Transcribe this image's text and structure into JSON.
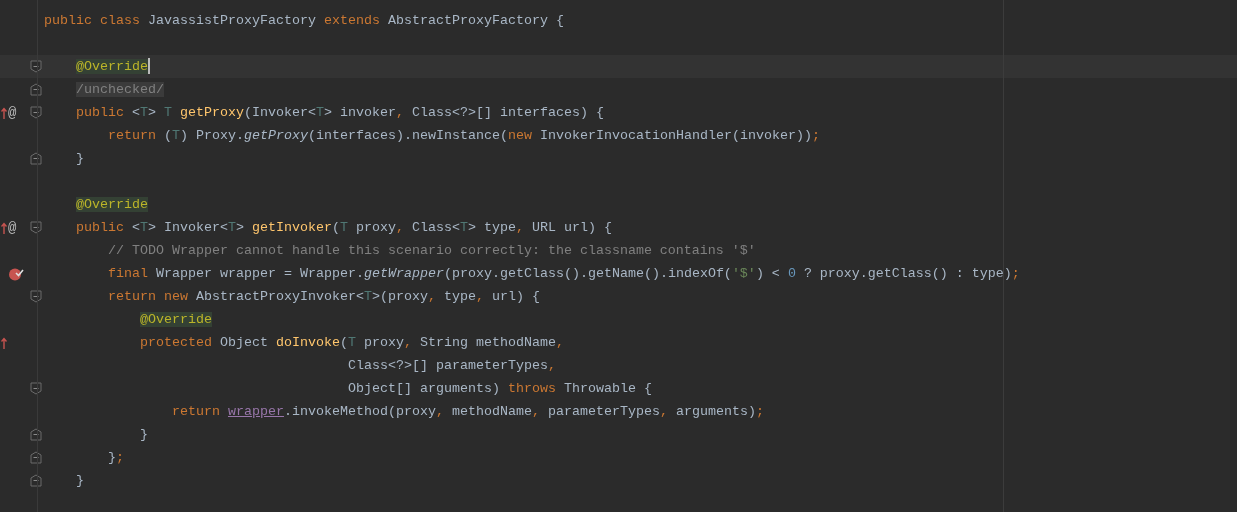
{
  "editor": {
    "lines": [
      {
        "current": false,
        "breakpoint": false,
        "overrides": false,
        "fold_start": false,
        "fold_end": false,
        "tokens": [
          {
            "kind": "k",
            "text": "public class"
          },
          {
            "kind": "p",
            "text": " JavassistProxyFactory "
          },
          {
            "kind": "k",
            "text": "extends"
          },
          {
            "kind": "p",
            "text": " AbstractProxyFactory {"
          }
        ]
      },
      {
        "current": false,
        "breakpoint": false,
        "overrides": false,
        "fold_start": false,
        "fold_end": false
      },
      {
        "current": true,
        "breakpoint": false,
        "overrides": false,
        "fold_start": true,
        "fold_end": false,
        "tokens": [
          {
            "kind": "a",
            "text": "    @Override"
          }
        ]
      },
      {
        "current": false,
        "breakpoint": false,
        "overrides": false,
        "fold_start": false,
        "fold_end": true,
        "tokens": [
          {
            "kind": "u",
            "text": "    /unchecked/"
          }
        ]
      },
      {
        "current": false,
        "breakpoint": false,
        "overrides": true,
        "gutter_symbol": "@",
        "fold_start": true,
        "fold_end": false,
        "tokens": [
          {
            "kind": "k",
            "text": "    public"
          },
          {
            "kind": "p",
            "text": " <"
          },
          {
            "kind": "t",
            "text": "T"
          },
          {
            "kind": "p",
            "text": "> "
          },
          {
            "kind": "t",
            "text": "T"
          },
          {
            "kind": "m",
            "text": " getProxy"
          },
          {
            "kind": "p",
            "text": "(Invoker<"
          },
          {
            "kind": "t",
            "text": "T"
          },
          {
            "kind": "p",
            "text": "> invoker"
          },
          {
            "kind": "k",
            "text": ","
          },
          {
            "kind": "p",
            "text": " Class<?>[] interfaces) {"
          }
        ]
      },
      {
        "current": false,
        "breakpoint": false,
        "overrides": false,
        "fold_start": false,
        "fold_end": false,
        "tokens": [
          {
            "kind": "k",
            "text": "        return"
          },
          {
            "kind": "p",
            "text": " ("
          },
          {
            "kind": "t",
            "text": "T"
          },
          {
            "kind": "p",
            "text": ") Proxy."
          },
          {
            "kind": "i",
            "text": "getProxy"
          },
          {
            "kind": "p",
            "text": "(interfaces).newInstance("
          },
          {
            "kind": "k",
            "text": "new"
          },
          {
            "kind": "p",
            "text": " InvokerInvocationHandler(invoker))"
          },
          {
            "kind": "k",
            "text": ";"
          }
        ]
      },
      {
        "current": false,
        "breakpoint": false,
        "overrides": false,
        "fold_start": false,
        "fold_end": true,
        "tokens": [
          {
            "kind": "p",
            "text": "    }"
          }
        ]
      },
      {
        "current": false,
        "breakpoint": false,
        "overrides": false,
        "fold_start": false,
        "fold_end": false
      },
      {
        "current": false,
        "breakpoint": false,
        "overrides": false,
        "fold_start": false,
        "fold_end": false,
        "tokens": [
          {
            "kind": "a",
            "text": "    @Override"
          }
        ]
      },
      {
        "current": false,
        "breakpoint": false,
        "overrides": true,
        "gutter_symbol": "@",
        "fold_start": true,
        "fold_end": false,
        "tokens": [
          {
            "kind": "k",
            "text": "    public"
          },
          {
            "kind": "p",
            "text": " <"
          },
          {
            "kind": "t",
            "text": "T"
          },
          {
            "kind": "p",
            "text": "> Invoker<"
          },
          {
            "kind": "t",
            "text": "T"
          },
          {
            "kind": "p",
            "text": "> "
          },
          {
            "kind": "m",
            "text": "getInvoker"
          },
          {
            "kind": "p",
            "text": "("
          },
          {
            "kind": "t",
            "text": "T"
          },
          {
            "kind": "p",
            "text": " proxy"
          },
          {
            "kind": "k",
            "text": ","
          },
          {
            "kind": "p",
            "text": " Class<"
          },
          {
            "kind": "t",
            "text": "T"
          },
          {
            "kind": "p",
            "text": "> type"
          },
          {
            "kind": "k",
            "text": ","
          },
          {
            "kind": "p",
            "text": " URL url) {"
          }
        ]
      },
      {
        "current": false,
        "breakpoint": false,
        "overrides": false,
        "fold_start": false,
        "fold_end": false,
        "tokens": [
          {
            "kind": "c",
            "text": "        // TODO Wrapper cannot handle this scenario correctly: the classname contains '$'"
          }
        ]
      },
      {
        "current": false,
        "breakpoint": true,
        "overrides": false,
        "fold_start": false,
        "fold_end": false,
        "tokens": [
          {
            "kind": "k",
            "text": "        final"
          },
          {
            "kind": "p",
            "text": " Wrapper wrapper = Wrapper."
          },
          {
            "kind": "i",
            "text": "getWrapper"
          },
          {
            "kind": "p",
            "text": "(proxy.getClass().getName().indexOf("
          },
          {
            "kind": "s",
            "text": "'$'"
          },
          {
            "kind": "p",
            "text": ") < "
          },
          {
            "kind": "n",
            "text": "0"
          },
          {
            "kind": "p",
            "text": " ? proxy.getClass() : type)"
          },
          {
            "kind": "k",
            "text": ";"
          }
        ]
      },
      {
        "current": false,
        "breakpoint": false,
        "overrides": false,
        "fold_start": true,
        "fold_end": false,
        "tokens": [
          {
            "kind": "k",
            "text": "        return new"
          },
          {
            "kind": "p",
            "text": " AbstractProxyInvoker<"
          },
          {
            "kind": "t",
            "text": "T"
          },
          {
            "kind": "p",
            "text": ">(proxy"
          },
          {
            "kind": "k",
            "text": ","
          },
          {
            "kind": "p",
            "text": " type"
          },
          {
            "kind": "k",
            "text": ","
          },
          {
            "kind": "p",
            "text": " url) {"
          }
        ]
      },
      {
        "current": false,
        "breakpoint": false,
        "overrides": false,
        "fold_start": false,
        "fold_end": false,
        "tokens": [
          {
            "kind": "a",
            "text": "            @Override"
          }
        ]
      },
      {
        "current": false,
        "breakpoint": false,
        "overrides": true,
        "fold_start": false,
        "fold_end": false,
        "tokens": [
          {
            "kind": "k",
            "text": "            protected"
          },
          {
            "kind": "p",
            "text": " Object "
          },
          {
            "kind": "m",
            "text": "doInvoke"
          },
          {
            "kind": "p",
            "text": "("
          },
          {
            "kind": "t",
            "text": "T"
          },
          {
            "kind": "p",
            "text": " proxy"
          },
          {
            "kind": "k",
            "text": ","
          },
          {
            "kind": "p",
            "text": " String methodName"
          },
          {
            "kind": "k",
            "text": ","
          }
        ]
      },
      {
        "current": false,
        "breakpoint": false,
        "overrides": false,
        "fold_start": false,
        "fold_end": false,
        "tokens": [
          {
            "kind": "p",
            "text": "                                      Class<?>[] parameterTypes"
          },
          {
            "kind": "k",
            "text": ","
          }
        ]
      },
      {
        "current": false,
        "breakpoint": false,
        "overrides": false,
        "fold_start": true,
        "fold_end": false,
        "tokens": [
          {
            "kind": "p",
            "text": "                                      Object[] arguments) "
          },
          {
            "kind": "k",
            "text": "throws"
          },
          {
            "kind": "p",
            "text": " Throwable {"
          }
        ]
      },
      {
        "current": false,
        "breakpoint": false,
        "overrides": false,
        "fold_start": false,
        "fold_end": false,
        "tokens": [
          {
            "kind": "k",
            "text": "                return "
          },
          {
            "kind": "f",
            "text": "wrapper"
          },
          {
            "kind": "p",
            "text": ".invokeMethod(proxy"
          },
          {
            "kind": "k",
            "text": ","
          },
          {
            "kind": "p",
            "text": " methodName"
          },
          {
            "kind": "k",
            "text": ","
          },
          {
            "kind": "p",
            "text": " parameterTypes"
          },
          {
            "kind": "k",
            "text": ","
          },
          {
            "kind": "p",
            "text": " arguments)"
          },
          {
            "kind": "k",
            "text": ";"
          }
        ]
      },
      {
        "current": false,
        "breakpoint": false,
        "overrides": false,
        "fold_start": false,
        "fold_end": true,
        "tokens": [
          {
            "kind": "p",
            "text": "            }"
          }
        ]
      },
      {
        "current": false,
        "breakpoint": false,
        "overrides": false,
        "fold_start": false,
        "fold_end": true,
        "tokens": [
          {
            "kind": "p",
            "text": "        }"
          },
          {
            "kind": "k",
            "text": ";"
          }
        ]
      },
      {
        "current": false,
        "breakpoint": false,
        "overrides": false,
        "fold_start": false,
        "fold_end": true,
        "tokens": [
          {
            "kind": "p",
            "text": "    }"
          }
        ]
      }
    ]
  }
}
